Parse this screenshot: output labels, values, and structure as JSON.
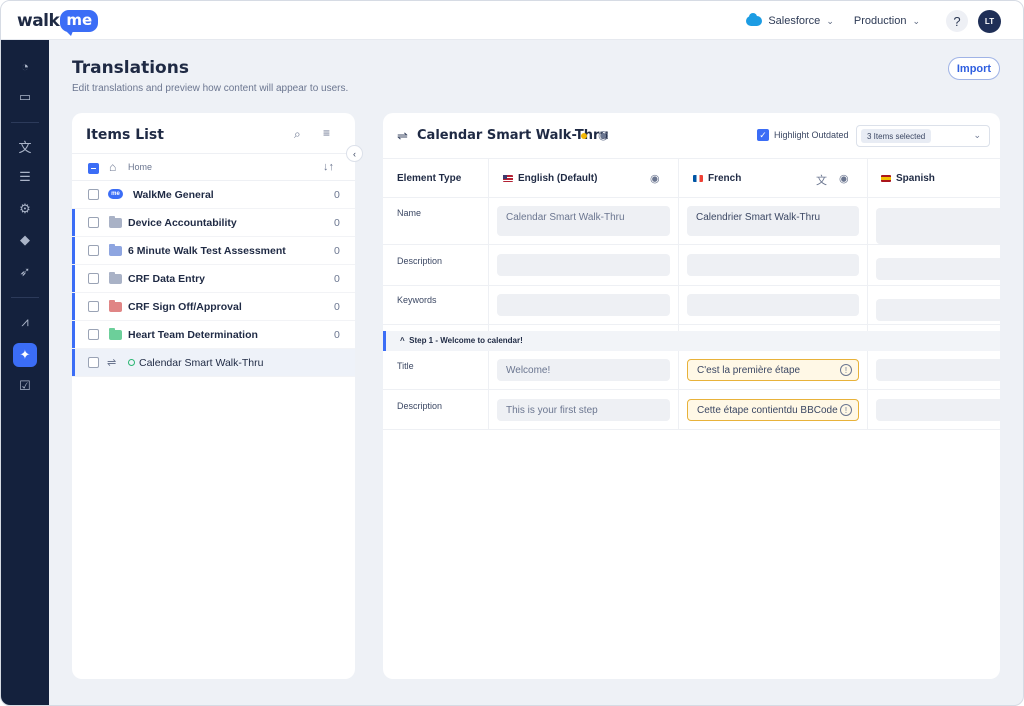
{
  "topbar": {
    "logo_walk": "walk",
    "logo_me": "me",
    "system_label": "Salesforce",
    "environment_label": "Production",
    "help_label": "?",
    "avatar_initials": "LT"
  },
  "page": {
    "title": "Translations",
    "subtitle": "Edit translations and preview how content will appear to users.",
    "import_label": "Import"
  },
  "items_list": {
    "title": "Items List",
    "home_label": "Home",
    "rows": [
      {
        "label": "WalkMe General",
        "count": "0",
        "icon": "walkme-icon"
      },
      {
        "label": "Device Accountability",
        "count": "0",
        "icon": "folder-icon",
        "color": "#a9b2c6"
      },
      {
        "label": "6 Minute Walk Test Assessment",
        "count": "0",
        "icon": "folder-icon",
        "color": "#8ea5e0"
      },
      {
        "label": "CRF Data Entry",
        "count": "0",
        "icon": "folder-icon",
        "color": "#a9b2c6"
      },
      {
        "label": "CRF Sign Off/Approval",
        "count": "0",
        "icon": "folder-icon",
        "color": "#e08585"
      },
      {
        "label": "Heart Team Determination",
        "count": "0",
        "icon": "folder-icon",
        "color": "#6ccf9a"
      },
      {
        "label": "Calendar Smart Walk-Thru",
        "count": "",
        "icon": "flow-icon"
      }
    ]
  },
  "translation_panel": {
    "title": "Calendar Smart Walk-Thru",
    "highlight_label": "Highlight Outdated",
    "selection_chip": "3 Items selected",
    "columns": {
      "element_type": "Element Type",
      "english": "English (Default)",
      "french": "French",
      "spanish": "Spanish"
    },
    "rows": {
      "name_label": "Name",
      "description_label": "Description",
      "keywords_label": "Keywords",
      "name_en": "Calendar Smart Walk-Thru",
      "name_fr": "Calendrier Smart Walk-Thru"
    },
    "step": {
      "label": "Step 1 - Welcome to calendar!",
      "title_label": "Title",
      "description_label": "Description",
      "title_en": "Welcome!",
      "title_fr": "C'est la première étape",
      "description_en": "This is your first step",
      "description_fr": "Cette étape contientdu BBCode"
    }
  },
  "colors": {
    "accent": "#3b6df6",
    "rail": "#14213d",
    "outdated": "#e8b23a"
  }
}
